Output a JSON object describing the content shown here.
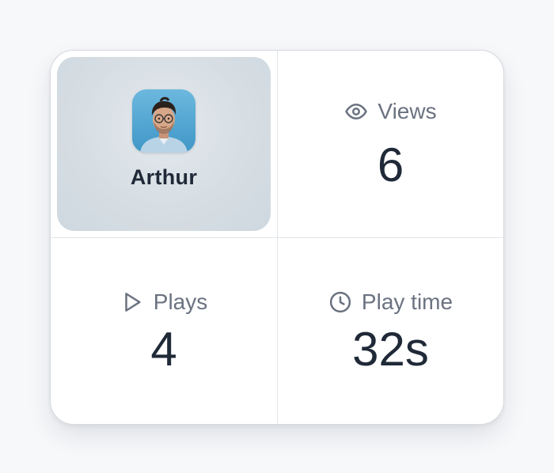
{
  "profile": {
    "name": "Arthur",
    "avatar_icon": "person-photo"
  },
  "stats": {
    "views": {
      "label": "Views",
      "value": "6",
      "icon": "eye-icon"
    },
    "plays": {
      "label": "Plays",
      "value": "4",
      "icon": "play-icon"
    },
    "play_time": {
      "label": "Play time",
      "value": "32s",
      "icon": "clock-icon"
    }
  },
  "colors": {
    "text_primary": "#1f2937",
    "text_secondary": "#6b7280",
    "border": "#d6d9de",
    "avatar_bg": "#5aaed6"
  }
}
